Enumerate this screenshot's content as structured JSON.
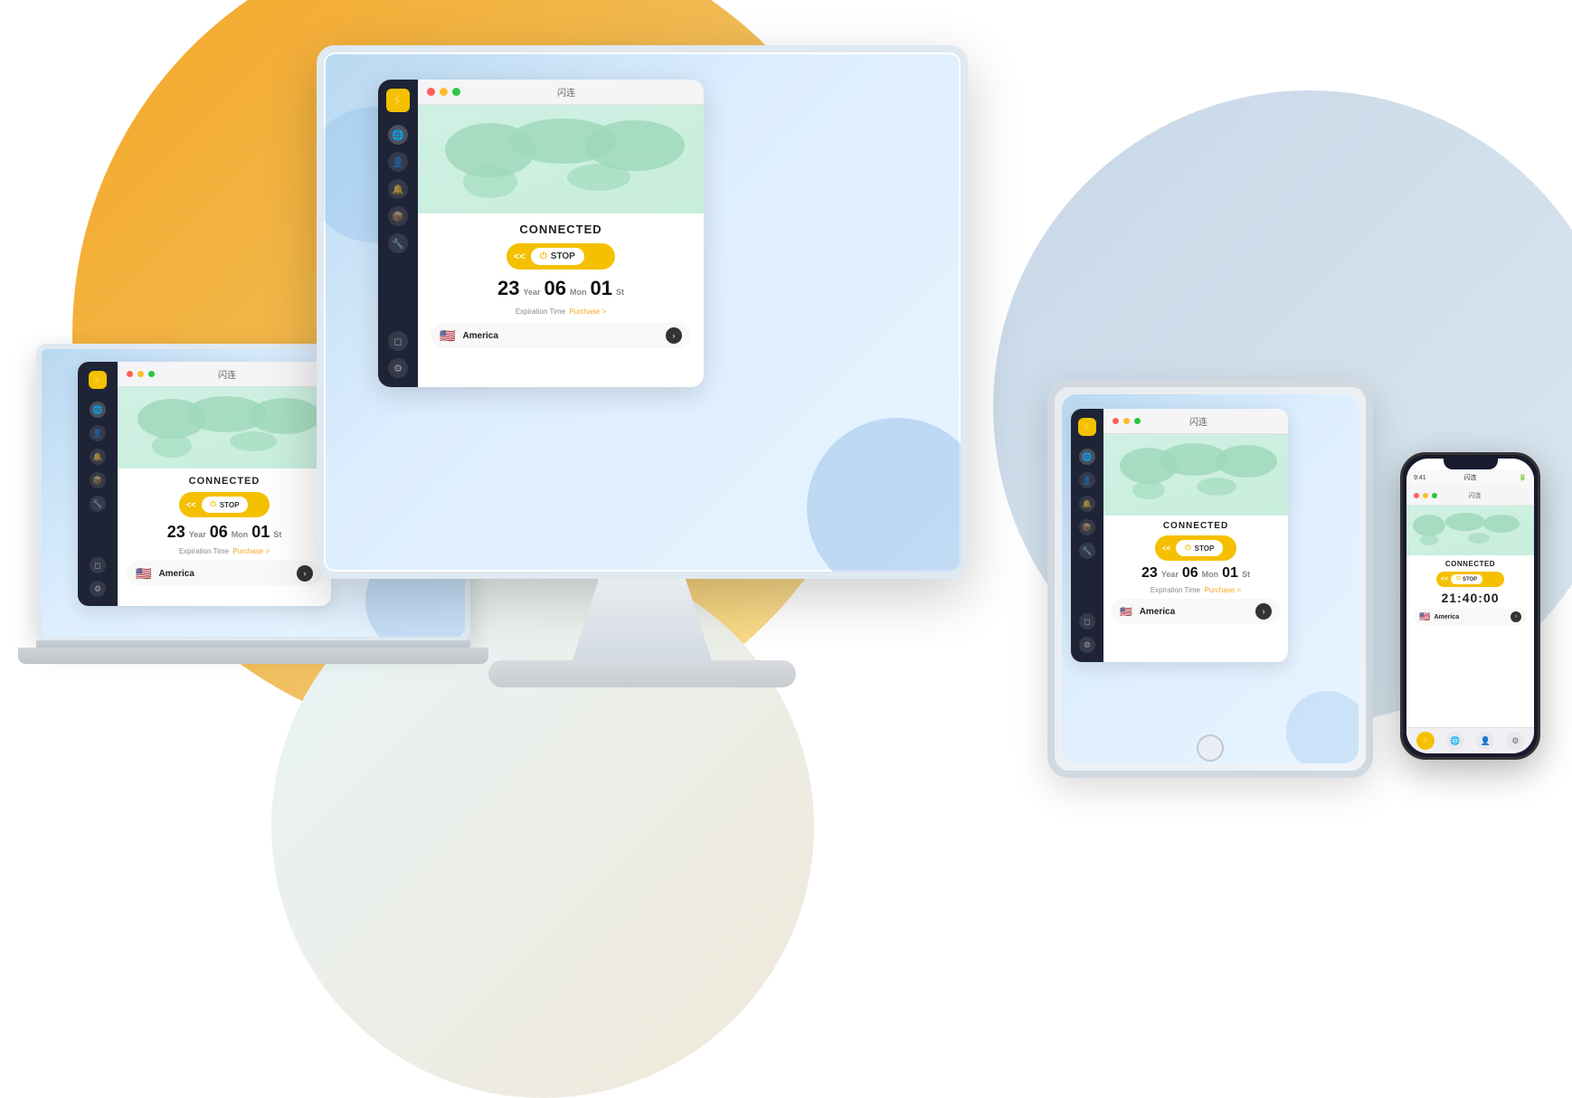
{
  "app": {
    "title": "闪连",
    "status": "CONNECTED",
    "stop_label": "STOP",
    "chevrons": "<<",
    "expiration_label": "Expiration Time",
    "purchase_label": "Purchase >",
    "location": "America",
    "time": {
      "years": "23",
      "year_label": "Year",
      "months": "06",
      "mon_label": "Mon",
      "days": "01",
      "day_label": "St"
    },
    "timer": "21:40:00",
    "sidebar_icons": [
      "☰",
      "●",
      "♡",
      "☆",
      "✦",
      "⚙",
      "□",
      "◎"
    ]
  },
  "devices": {
    "imac": "iMac",
    "laptop": "MacBook",
    "tablet": "iPad",
    "phone": "iPhone"
  }
}
